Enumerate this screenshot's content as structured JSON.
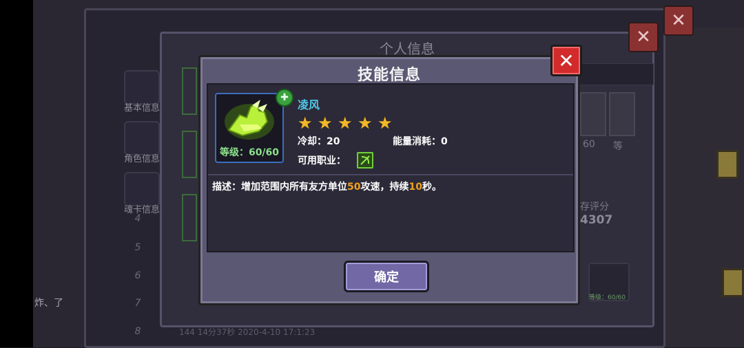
{
  "background": {
    "back_title": "个人信息",
    "menu": [
      {
        "label": "基本信息",
        "icon": "star-icon"
      },
      {
        "label": "角色信息",
        "icon": "helmet-icon"
      },
      {
        "label": "魂卡信息",
        "icon": "card-icon"
      }
    ],
    "row_numbers": [
      "4",
      "5",
      "6",
      "7",
      "8"
    ],
    "score_label": "存评分",
    "score_value": "4307",
    "avatar_level": "60",
    "avatar_level2": "等",
    "skill_level": "等级：60/60",
    "player_caption": "炸、了",
    "bottom_row": "144    14分37秒    2020-4-10 17:1:23"
  },
  "dialog": {
    "title": "技能信息",
    "skill": {
      "name": "凌风",
      "stars": 5,
      "level_text": "等级：60/60",
      "cooldown_label": "冷却：",
      "cooldown_value": "20",
      "energy_label": "能量消耗：",
      "energy_value": "0",
      "class_label": "可用职业："
    },
    "description": {
      "prefix": "描述：增加范围内所有友方单位",
      "value1": "50",
      "middle": "攻速，持续",
      "value2": "10",
      "suffix": "秒。"
    },
    "confirm_label": "确定"
  },
  "colors": {
    "skill_name": "#4fc7e8",
    "highlight": "#f0a020",
    "level_text": "#8ee08c",
    "close_red": "#d22b2b",
    "button_purple": "#7268a6"
  }
}
